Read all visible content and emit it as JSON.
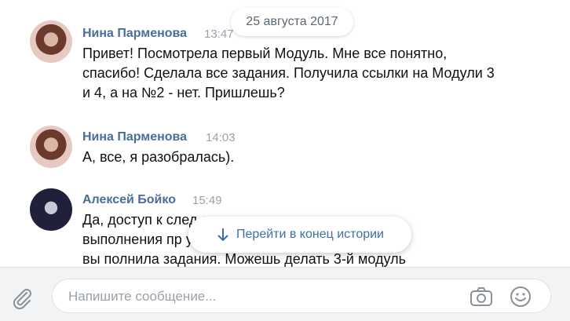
{
  "date_label": "25 августа 2017",
  "messages": [
    {
      "author": "Нина Парменова",
      "time": "13:47",
      "text": "Привет! Посмотрела первый Модуль. Мне все понятно,\nспасибо! Сделала все задания. Получила ссылки на Модули 3\nи 4, а на №2 - нет. Пришлешь?"
    },
    {
      "author": "Нина Парменова",
      "time": "14:03",
      "text": "А, все, я разобралась)."
    },
    {
      "author": "Алексей Бойко",
      "time": "15:49",
      "text": "Да, доступ к след                                         ется после\nвыполнения пр                                          уп тебе т.к. ты\nвы полнила задания. Можешь делать 3-й модуль"
    }
  ],
  "jump_button": {
    "label": "Перейти в конец истории",
    "icon": "arrow-down-icon"
  },
  "composer": {
    "placeholder": "Напишите сообщение...",
    "attach_icon": "paperclip-icon",
    "camera_icon": "camera-icon",
    "emoji_icon": "smile-icon"
  },
  "colors": {
    "author": "#4a6d99",
    "time": "#9aa3ad",
    "link": "#3d6fa6"
  }
}
